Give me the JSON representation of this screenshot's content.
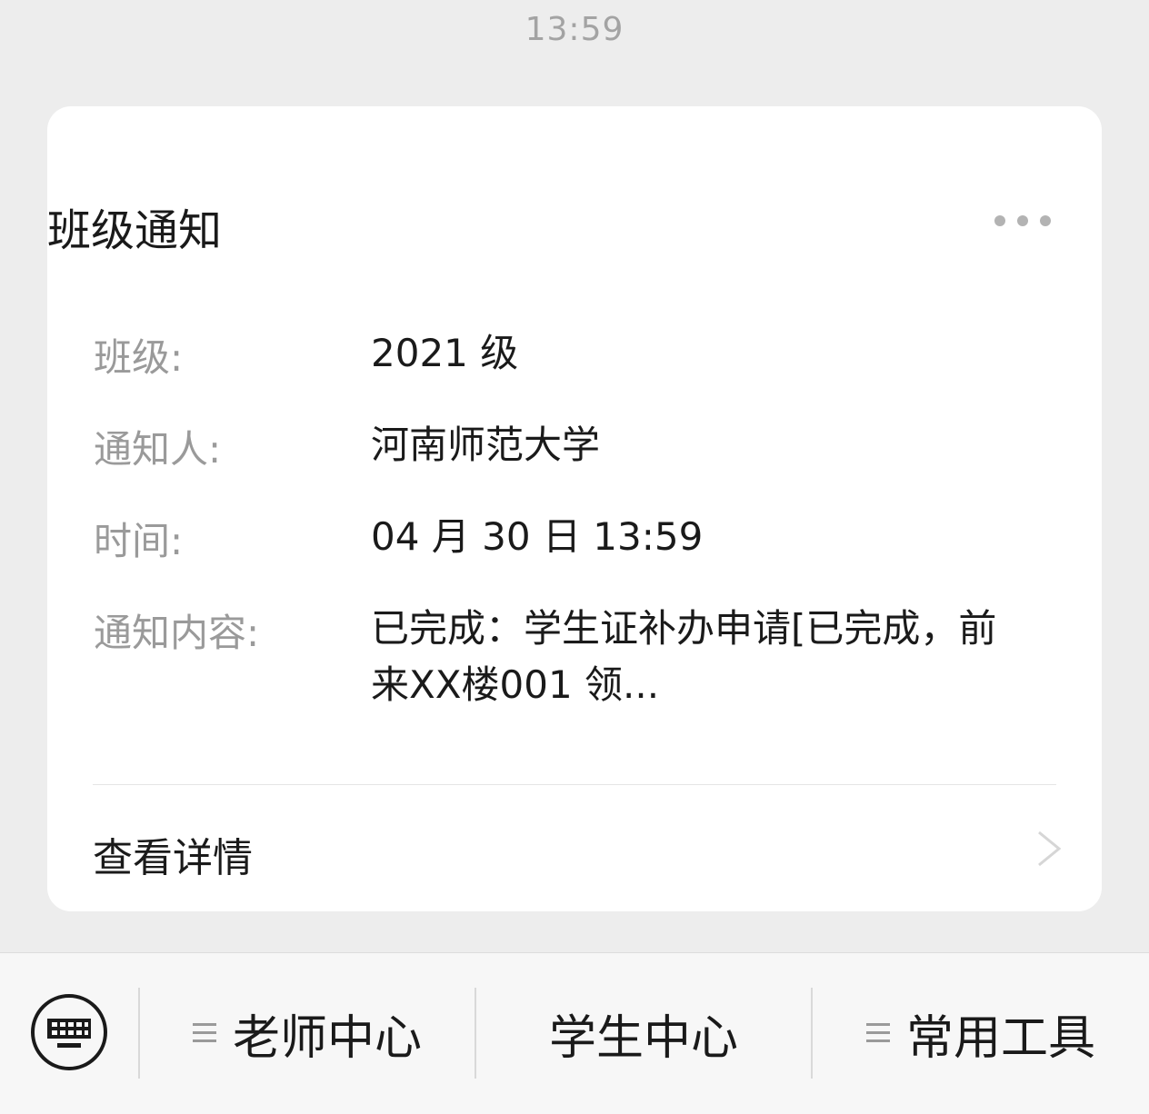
{
  "chat": {
    "timestamp": "13:59"
  },
  "card": {
    "title": "班级通知",
    "more_icon": "more-dots-icon",
    "fields": [
      {
        "label": "班级:",
        "value": "2021 级"
      },
      {
        "label": "通知人:",
        "value": "河南师范大学"
      },
      {
        "label": "时间:",
        "value": "04 月 30 日 13:59"
      },
      {
        "label": "通知内容:",
        "value": "已完成：学生证补办申请[已完成，前来XX楼001 领..."
      }
    ],
    "detail_label": "查看详情",
    "detail_icon": "chevron-right-icon"
  },
  "menu": {
    "keyboard_icon": "keyboard-icon",
    "items": [
      {
        "label": "老师中心",
        "has_submenu": true
      },
      {
        "label": "学生中心",
        "has_submenu": false
      },
      {
        "label": "常用工具",
        "has_submenu": true
      }
    ]
  },
  "colors": {
    "background": "#ededed",
    "card": "#ffffff",
    "label": "#9a9a9a",
    "text": "#1a1a1a"
  }
}
